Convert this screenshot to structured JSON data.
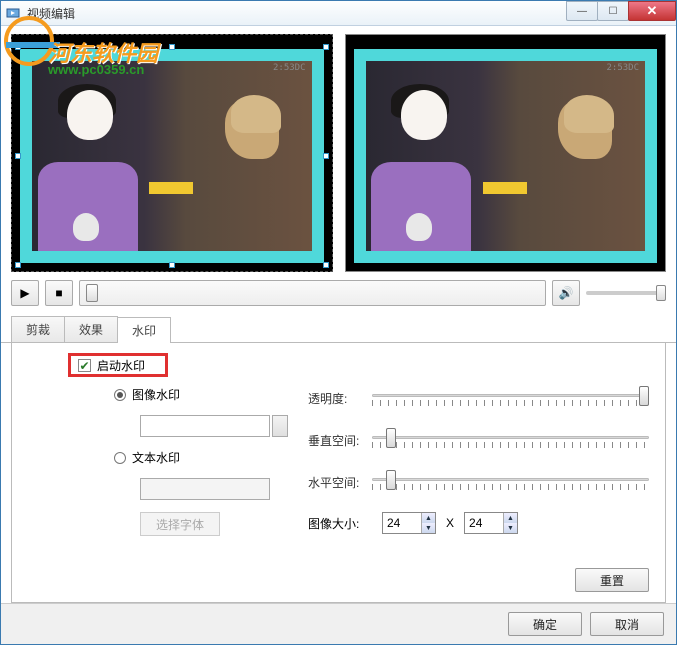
{
  "window": {
    "title": "视频编辑"
  },
  "watermark_logo": {
    "text": "河东软件园",
    "url": "www.pc0359.cn"
  },
  "preview": {
    "timestamp": "2:53DC"
  },
  "tabs": {
    "crop": "剪裁",
    "effect": "效果",
    "watermark": "水印"
  },
  "panel": {
    "enable_watermark": "启动水印",
    "image_watermark": "图像水印",
    "text_watermark": "文本水印",
    "choose_font": "选择字体",
    "opacity": "透明度:",
    "v_space": "垂直空间:",
    "h_space": "水平空间:",
    "image_size": "图像大小:",
    "size_sep": "X",
    "width": "24",
    "height": "24",
    "reset": "重置"
  },
  "buttons": {
    "ok": "确定",
    "cancel": "取消"
  },
  "icons": {
    "min": "—",
    "max": "☐",
    "close": "✕",
    "play": "▶",
    "stop": "■",
    "speaker": "🔊",
    "check": "✔",
    "up": "▲",
    "down": "▼"
  }
}
